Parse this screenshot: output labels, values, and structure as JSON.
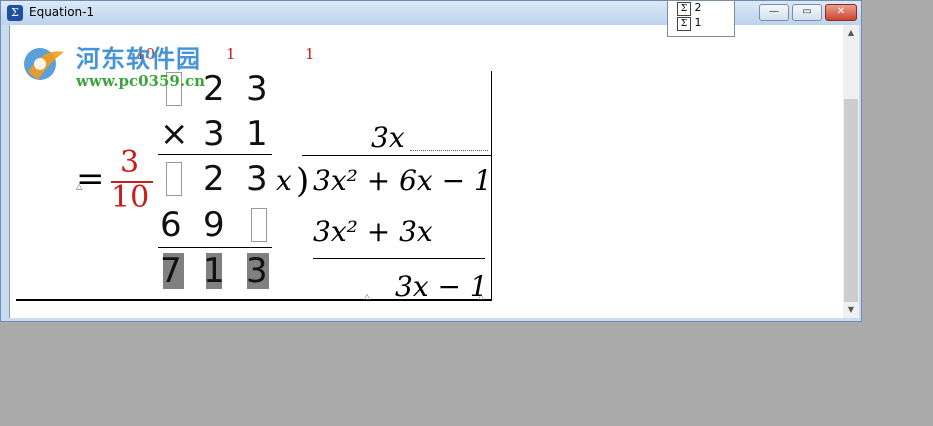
{
  "window": {
    "title": "Equation-1"
  },
  "popup": {
    "items": [
      "2",
      "1"
    ]
  },
  "watermark": {
    "chinese": "河东软件园",
    "url": "www.pc0359.cn"
  },
  "top_fragments": {
    "red_a": "10",
    "red_b": "1",
    "red_c": "1"
  },
  "equation": {
    "equals": "=",
    "fraction": {
      "numerator": "3",
      "denominator": "10"
    },
    "mult_rows": [
      [
        "",
        "2",
        "3"
      ],
      [
        "×",
        "3",
        "1"
      ],
      [
        "",
        "2",
        "3"
      ],
      [
        "6",
        "9",
        ""
      ],
      [
        "7",
        "1",
        "3"
      ]
    ],
    "division": {
      "quotient": "3x",
      "divisor": "x",
      "dividend": "3x² + 6x − 1",
      "step1": "3x² + 3x",
      "remainder": "3x − 1"
    }
  }
}
